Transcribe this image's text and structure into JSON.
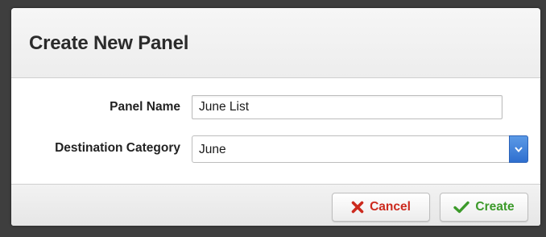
{
  "dialog": {
    "title": "Create New Panel"
  },
  "form": {
    "panel_name_label": "Panel Name",
    "panel_name_value": "June List",
    "destination_label": "Destination Category",
    "destination_value": "June"
  },
  "footer": {
    "cancel_label": "Cancel",
    "create_label": "Create"
  },
  "icons": {
    "cancel": "x-icon",
    "create": "checkmark-icon",
    "select_arrow": "chevron-down-icon"
  },
  "colors": {
    "cancel": "#cc2a1e",
    "create": "#3c9a2a",
    "select_arrow": "#2f6fcf"
  }
}
